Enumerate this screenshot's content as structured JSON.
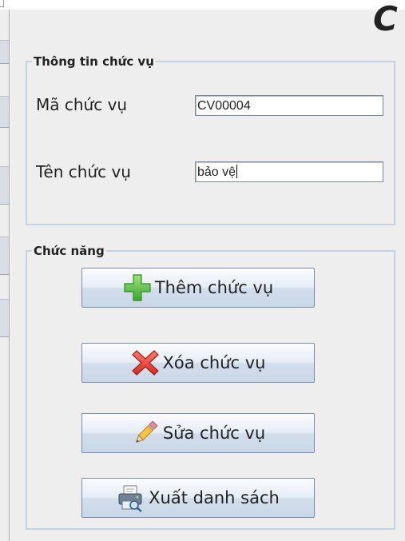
{
  "header": {
    "title_fragment": "C"
  },
  "info_group": {
    "legend": "Thông tin chức vụ",
    "code_label": "Mã chức vụ",
    "code_value": "CV00004",
    "name_label": "Tên chức vụ",
    "name_value": "bảo vệ"
  },
  "actions_group": {
    "legend": "Chức năng",
    "buttons": [
      {
        "label": "Thêm chức vụ",
        "icon": "plus-icon"
      },
      {
        "label": "Xóa chức vụ",
        "icon": "delete-x-icon"
      },
      {
        "label": "Sửa chức vụ",
        "icon": "pencil-icon"
      },
      {
        "label": "Xuất danh sách",
        "icon": "printer-icon"
      }
    ]
  },
  "colors": {
    "panel_bg": "#eeeeee",
    "group_border": "#c3d3e6",
    "add_green": "#5cc24a",
    "delete_red": "#e03a3a"
  }
}
